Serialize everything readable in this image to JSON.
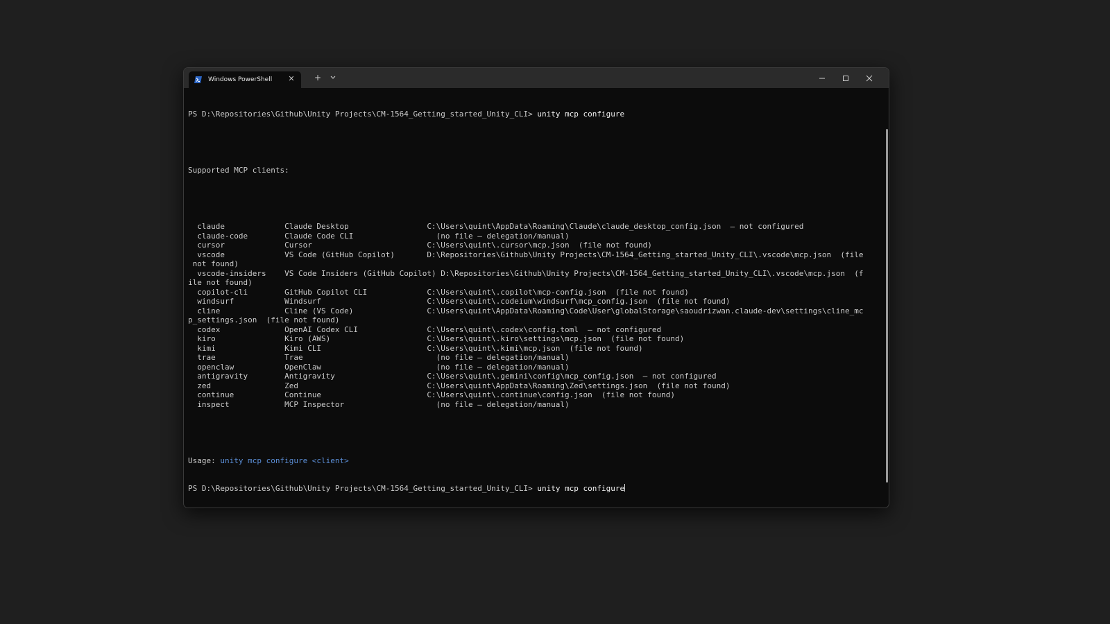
{
  "window": {
    "tab_title": "Windows PowerShell",
    "tab_icon": "powershell-icon",
    "new_tab_icon": "plus-icon",
    "dropdown_icon": "chevron-down-icon"
  },
  "terminal": {
    "prompt": "PS D:\\Repositories\\Github\\Unity Projects\\CM-1564_Getting_started_Unity_CLI>",
    "command": "unity mcp configure",
    "supported_header": "Supported MCP clients:",
    "clients": [
      {
        "id": "claude",
        "name": "Claude Desktop",
        "path": "C:\\Users\\quint\\AppData\\Roaming\\Claude\\claude_desktop_config.json  – not configured"
      },
      {
        "id": "claude-code",
        "name": "Claude Code CLI",
        "path": "  (no file – delegation/manual)"
      },
      {
        "id": "cursor",
        "name": "Cursor",
        "path": "C:\\Users\\quint\\.cursor\\mcp.json  (file not found)"
      },
      {
        "id": "vscode",
        "name": "VS Code (GitHub Copilot)",
        "path": "D:\\Repositories\\Github\\Unity Projects\\CM-1564_Getting_started_Unity_CLI\\.vscode\\mcp.json  (file",
        "wrap": " not found)"
      },
      {
        "id": "vscode-insiders",
        "name": "VS Code Insiders (GitHub Copilot)",
        "path": "D:\\Repositories\\Github\\Unity Projects\\CM-1564_Getting_started_Unity_CLI\\.vscode\\mcp.json  (f",
        "wrap": "ile not found)"
      },
      {
        "id": "copilot-cli",
        "name": "GitHub Copilot CLI",
        "path": "C:\\Users\\quint\\.copilot\\mcp-config.json  (file not found)"
      },
      {
        "id": "windsurf",
        "name": "Windsurf",
        "path": "C:\\Users\\quint\\.codeium\\windsurf\\mcp_config.json  (file not found)"
      },
      {
        "id": "cline",
        "name": "Cline (VS Code)",
        "path": "C:\\Users\\quint\\AppData\\Roaming\\Code\\User\\globalStorage\\saoudrizwan.claude-dev\\settings\\cline_mc",
        "wrap": "p_settings.json  (file not found)"
      },
      {
        "id": "codex",
        "name": "OpenAI Codex CLI",
        "path": "C:\\Users\\quint\\.codex\\config.toml  – not configured"
      },
      {
        "id": "kiro",
        "name": "Kiro (AWS)",
        "path": "C:\\Users\\quint\\.kiro\\settings\\mcp.json  (file not found)"
      },
      {
        "id": "kimi",
        "name": "Kimi CLI",
        "path": "C:\\Users\\quint\\.kimi\\mcp.json  (file not found)"
      },
      {
        "id": "trae",
        "name": "Trae",
        "path": "  (no file – delegation/manual)"
      },
      {
        "id": "openclaw",
        "name": "OpenClaw",
        "path": "  (no file – delegation/manual)"
      },
      {
        "id": "antigravity",
        "name": "Antigravity",
        "path": "C:\\Users\\quint\\.gemini\\config\\mcp_config.json  – not configured"
      },
      {
        "id": "zed",
        "name": "Zed",
        "path": "C:\\Users\\quint\\AppData\\Roaming\\Zed\\settings.json  (file not found)"
      },
      {
        "id": "continue",
        "name": "Continue",
        "path": "C:\\Users\\quint\\.continue\\config.json  (file not found)"
      },
      {
        "id": "inspect",
        "name": "MCP Inspector",
        "path": "  (no file – delegation/manual)"
      }
    ],
    "usage_label": "Usage: ",
    "usage_value": "unity mcp configure <client>",
    "colors": {
      "background": "#0c0c0c",
      "text": "#cccccc",
      "usage_highlight": "#5b8ed6"
    }
  }
}
